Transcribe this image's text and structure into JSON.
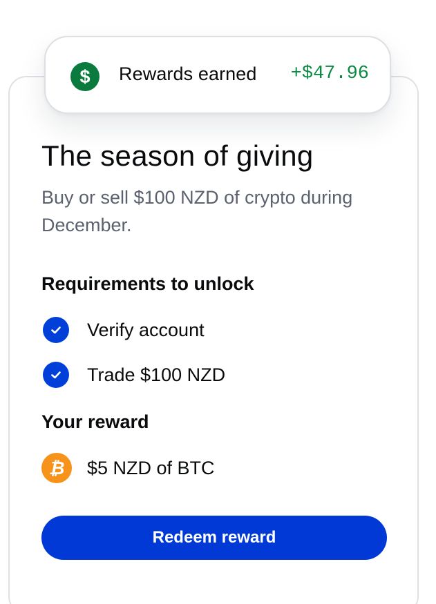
{
  "rewards_pill": {
    "icon": "dollar-sign-icon",
    "label": "Rewards earned",
    "amount": "+$47.96",
    "icon_color": "#0b7a3f",
    "amount_color": "#0b8a43"
  },
  "promo": {
    "title": "The season of giving",
    "subtitle": "Buy or sell $100 NZD of crypto during December."
  },
  "requirements": {
    "heading": "Requirements to unlock",
    "items": [
      {
        "icon": "checkmark-circle-icon",
        "label": "Verify account",
        "completed": true
      },
      {
        "icon": "checkmark-circle-icon",
        "label": "Trade $100 NZD",
        "completed": true
      }
    ]
  },
  "reward": {
    "heading": "Your reward",
    "icon": "bitcoin-icon",
    "label": "$5 NZD of BTC",
    "icon_color": "#f7931a"
  },
  "cta": {
    "label": "Redeem reward",
    "color": "#0039d6"
  }
}
